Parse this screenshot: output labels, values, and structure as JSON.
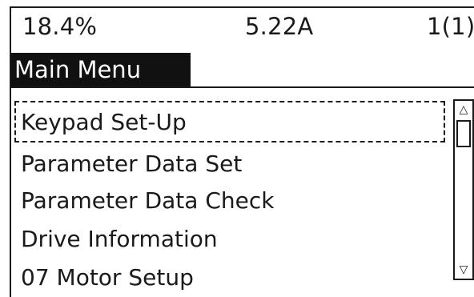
{
  "status": {
    "left": "18.4%",
    "center": "5.22A",
    "right": "1(1)"
  },
  "title": "Main Menu",
  "menu": {
    "items": [
      "Keypad Set-Up",
      "Parameter Data Set",
      "Parameter Data Check",
      "Drive Information",
      "07  Motor Setup"
    ],
    "focused_index": 0
  },
  "scrollbar": {
    "up_icon": "triangle-up-icon",
    "down_icon": "triangle-down-icon"
  },
  "colors": {
    "text": "#1a1a1a",
    "highlight": "#111111",
    "background": "#ffffff"
  }
}
